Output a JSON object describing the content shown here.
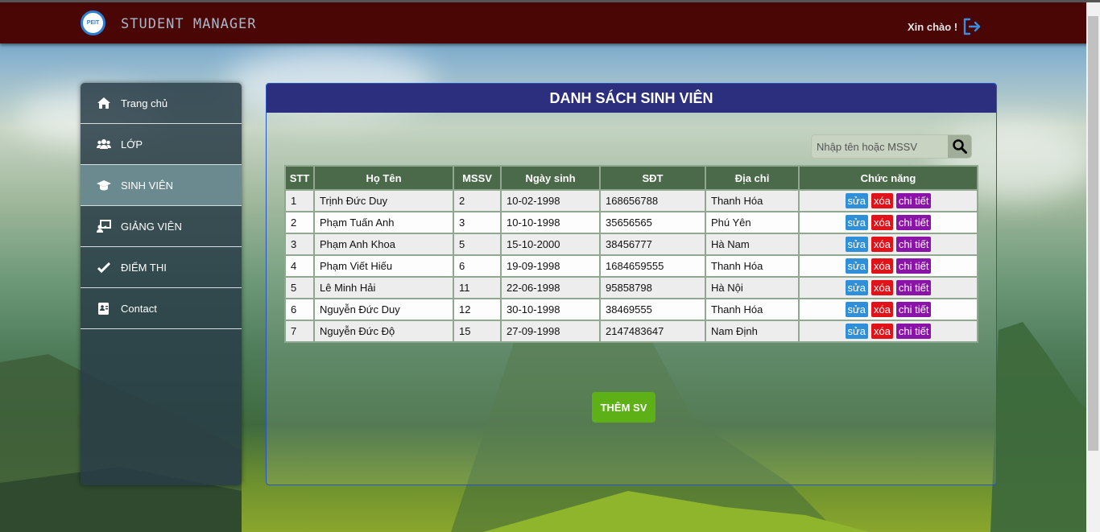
{
  "header": {
    "brand": "STUDENT MANAGER",
    "logo_text": "PEIT",
    "greeting": "Xin chào !",
    "logout_icon": "logout-icon"
  },
  "sidebar": {
    "items": [
      {
        "label": "Trang chủ",
        "icon": "home-icon"
      },
      {
        "label": "LỚP",
        "icon": "users-icon"
      },
      {
        "label": "SINH VIÊN",
        "icon": "graduation-cap-icon"
      },
      {
        "label": "GIẢNG VIÊN",
        "icon": "chalkboard-teacher-icon"
      },
      {
        "label": "ĐIỂM THI",
        "icon": "check-icon"
      },
      {
        "label": "Contact",
        "icon": "contact-card-icon"
      }
    ]
  },
  "main": {
    "title": "DANH SÁCH SINH VIÊN",
    "search": {
      "placeholder": "Nhập tên hoặc MSSV"
    },
    "table": {
      "headers": [
        "STT",
        "Họ Tên",
        "MSSV",
        "Ngày sinh",
        "SĐT",
        "Địa chỉ",
        "Chức năng"
      ],
      "rows": [
        [
          "1",
          "Trịnh Đức Duy",
          "2",
          "10-02-1998",
          "168656788",
          "Thanh Hóa"
        ],
        [
          "2",
          "Phạm Tuấn Anh",
          "3",
          "10-10-1998",
          "35656565",
          "Phú Yên"
        ],
        [
          "3",
          "Phạm Anh Khoa",
          "5",
          "15-10-2000",
          "38456777",
          "Hà Nam"
        ],
        [
          "4",
          "Phạm Viết Hiếu",
          "6",
          "19-09-1998",
          "1684659555",
          "Thanh Hóa"
        ],
        [
          "5",
          "Lê Minh Hải",
          "11",
          "22-06-1998",
          "95858798",
          "Hà Nội"
        ],
        [
          "6",
          "Nguyễn Đức Duy",
          "12",
          "30-10-1998",
          "38469555",
          "Thanh Hóa"
        ],
        [
          "7",
          "Nguyễn Đức Độ",
          "15",
          "27-09-1998",
          "2147483647",
          "Nam Định"
        ]
      ],
      "actions": {
        "edit": "sửa",
        "delete": "xóa",
        "detail": "chi  tiết"
      }
    },
    "add_button": "THÊM SV"
  },
  "colors": {
    "topbar": "#4a0505",
    "panel_title": "#2b2f7e",
    "table_header": "#4a6a4a",
    "edit": "#2f8fd8",
    "delete": "#e0131a",
    "detail": "#8a14a8",
    "add": "#5db016"
  }
}
